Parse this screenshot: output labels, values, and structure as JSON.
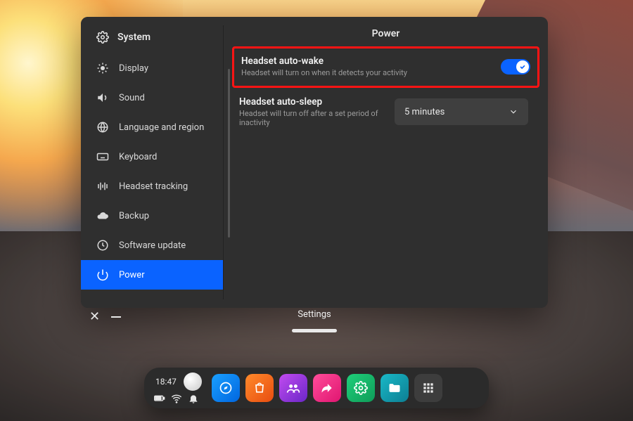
{
  "sidebar": {
    "title": "System",
    "items": [
      {
        "icon": "brightness-icon",
        "label": "Display"
      },
      {
        "icon": "volume-icon",
        "label": "Sound"
      },
      {
        "icon": "globe-icon",
        "label": "Language and region"
      },
      {
        "icon": "keyboard-icon",
        "label": "Keyboard"
      },
      {
        "icon": "tracking-icon",
        "label": "Headset tracking"
      },
      {
        "icon": "cloud-icon",
        "label": "Backup"
      },
      {
        "icon": "update-icon",
        "label": "Software update"
      },
      {
        "icon": "power-icon",
        "label": "Power"
      }
    ]
  },
  "main": {
    "title": "Power",
    "auto_wake": {
      "title": "Headset auto-wake",
      "desc": "Headset will turn on when it detects your activity",
      "toggle_on": true
    },
    "auto_sleep": {
      "title": "Headset auto-sleep",
      "desc": "Headset will turn off after a set period of inactivity",
      "selected": "5 minutes"
    }
  },
  "window": {
    "label": "Settings"
  },
  "dock": {
    "time": "18:47",
    "apps": [
      {
        "name": "explore",
        "color": "blue"
      },
      {
        "name": "store",
        "color": "orange"
      },
      {
        "name": "people",
        "color": "pink"
      },
      {
        "name": "share",
        "color": "magenta"
      },
      {
        "name": "settings",
        "color": "green"
      },
      {
        "name": "files",
        "color": "teal"
      },
      {
        "name": "apps",
        "color": "grid"
      }
    ]
  },
  "colors": {
    "accent": "#0a63ff",
    "highlight": "#ff1414"
  }
}
